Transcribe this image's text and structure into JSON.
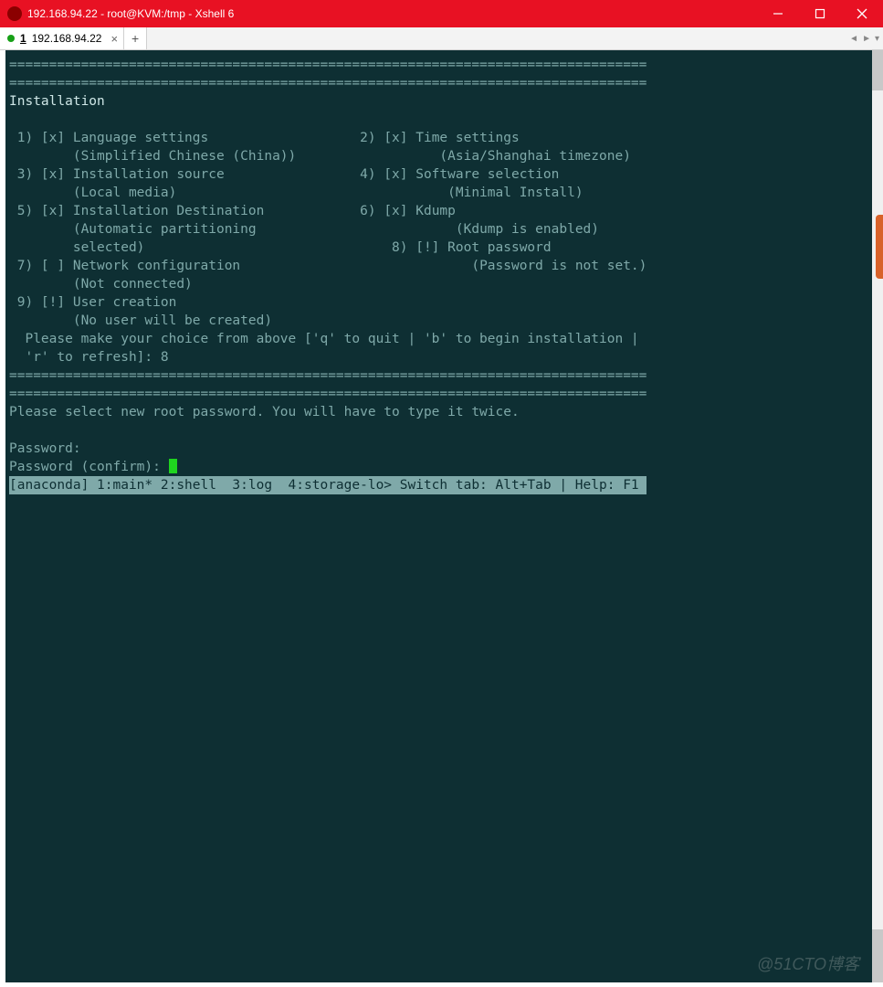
{
  "window": {
    "title": "192.168.94.22 - root@KVM:/tmp - Xshell 6"
  },
  "tab": {
    "index": "1",
    "label": "192.168.94.22",
    "close_glyph": "×"
  },
  "newtab_glyph": "+",
  "arrows": {
    "left": "◄",
    "right": "►",
    "down": "▾"
  },
  "divider": "================================================================================",
  "term": {
    "header": "Installation",
    "items": {
      "i1": {
        "label": " 1) [x] Language settings",
        "sub": "        (Simplified Chinese (China))"
      },
      "i2": {
        "label": "2) [x] Time settings",
        "sub": "       (Asia/Shanghai timezone)"
      },
      "i3": {
        "label": " 3) [x] Installation source",
        "sub": "        (Local media)"
      },
      "i4": {
        "label": "4) [x] Software selection",
        "sub": "       (Minimal Install)"
      },
      "i5": {
        "label": " 5) [x] Installation Destination",
        "sub": "        (Automatic partitioning",
        "sub2": "        selected)"
      },
      "i6": {
        "label": "6) [x] Kdump",
        "sub": "       (Kdump is enabled)"
      },
      "i7": {
        "label": " 7) [ ] Network configuration",
        "sub": "        (Not connected)"
      },
      "i8": {
        "label": "8) [!] Root password",
        "sub": "       (Password is not set.)"
      },
      "i9": {
        "label": " 9) [!] User creation",
        "sub": "        (No user will be created)"
      }
    },
    "prompt1": "  Please make your choice from above ['q' to quit | 'b' to begin installation |",
    "prompt2": "  'r' to refresh]: 8",
    "passmsg": "Please select new root password. You will have to type it twice.",
    "pw1": "Password: ",
    "pw2": "Password (confirm): ",
    "status": "[anaconda] 1:main* 2:shell  3:log  4:storage-lo> Switch tab: Alt+Tab | Help: F1 "
  },
  "watermark": "@51CTO博客"
}
